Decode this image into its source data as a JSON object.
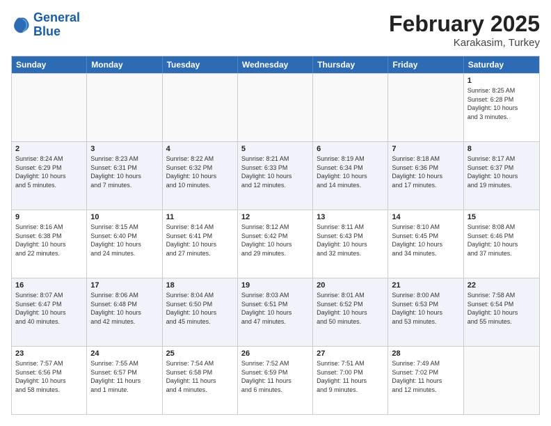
{
  "logo": {
    "line1": "General",
    "line2": "Blue"
  },
  "title": "February 2025",
  "subtitle": "Karakasim, Turkey",
  "days_of_week": [
    "Sunday",
    "Monday",
    "Tuesday",
    "Wednesday",
    "Thursday",
    "Friday",
    "Saturday"
  ],
  "weeks": [
    {
      "alt": false,
      "cells": [
        {
          "day": "",
          "info": ""
        },
        {
          "day": "",
          "info": ""
        },
        {
          "day": "",
          "info": ""
        },
        {
          "day": "",
          "info": ""
        },
        {
          "day": "",
          "info": ""
        },
        {
          "day": "",
          "info": ""
        },
        {
          "day": "1",
          "info": "Sunrise: 8:25 AM\nSunset: 6:28 PM\nDaylight: 10 hours\nand 3 minutes."
        }
      ]
    },
    {
      "alt": true,
      "cells": [
        {
          "day": "2",
          "info": "Sunrise: 8:24 AM\nSunset: 6:29 PM\nDaylight: 10 hours\nand 5 minutes."
        },
        {
          "day": "3",
          "info": "Sunrise: 8:23 AM\nSunset: 6:31 PM\nDaylight: 10 hours\nand 7 minutes."
        },
        {
          "day": "4",
          "info": "Sunrise: 8:22 AM\nSunset: 6:32 PM\nDaylight: 10 hours\nand 10 minutes."
        },
        {
          "day": "5",
          "info": "Sunrise: 8:21 AM\nSunset: 6:33 PM\nDaylight: 10 hours\nand 12 minutes."
        },
        {
          "day": "6",
          "info": "Sunrise: 8:19 AM\nSunset: 6:34 PM\nDaylight: 10 hours\nand 14 minutes."
        },
        {
          "day": "7",
          "info": "Sunrise: 8:18 AM\nSunset: 6:36 PM\nDaylight: 10 hours\nand 17 minutes."
        },
        {
          "day": "8",
          "info": "Sunrise: 8:17 AM\nSunset: 6:37 PM\nDaylight: 10 hours\nand 19 minutes."
        }
      ]
    },
    {
      "alt": false,
      "cells": [
        {
          "day": "9",
          "info": "Sunrise: 8:16 AM\nSunset: 6:38 PM\nDaylight: 10 hours\nand 22 minutes."
        },
        {
          "day": "10",
          "info": "Sunrise: 8:15 AM\nSunset: 6:40 PM\nDaylight: 10 hours\nand 24 minutes."
        },
        {
          "day": "11",
          "info": "Sunrise: 8:14 AM\nSunset: 6:41 PM\nDaylight: 10 hours\nand 27 minutes."
        },
        {
          "day": "12",
          "info": "Sunrise: 8:12 AM\nSunset: 6:42 PM\nDaylight: 10 hours\nand 29 minutes."
        },
        {
          "day": "13",
          "info": "Sunrise: 8:11 AM\nSunset: 6:43 PM\nDaylight: 10 hours\nand 32 minutes."
        },
        {
          "day": "14",
          "info": "Sunrise: 8:10 AM\nSunset: 6:45 PM\nDaylight: 10 hours\nand 34 minutes."
        },
        {
          "day": "15",
          "info": "Sunrise: 8:08 AM\nSunset: 6:46 PM\nDaylight: 10 hours\nand 37 minutes."
        }
      ]
    },
    {
      "alt": true,
      "cells": [
        {
          "day": "16",
          "info": "Sunrise: 8:07 AM\nSunset: 6:47 PM\nDaylight: 10 hours\nand 40 minutes."
        },
        {
          "day": "17",
          "info": "Sunrise: 8:06 AM\nSunset: 6:48 PM\nDaylight: 10 hours\nand 42 minutes."
        },
        {
          "day": "18",
          "info": "Sunrise: 8:04 AM\nSunset: 6:50 PM\nDaylight: 10 hours\nand 45 minutes."
        },
        {
          "day": "19",
          "info": "Sunrise: 8:03 AM\nSunset: 6:51 PM\nDaylight: 10 hours\nand 47 minutes."
        },
        {
          "day": "20",
          "info": "Sunrise: 8:01 AM\nSunset: 6:52 PM\nDaylight: 10 hours\nand 50 minutes."
        },
        {
          "day": "21",
          "info": "Sunrise: 8:00 AM\nSunset: 6:53 PM\nDaylight: 10 hours\nand 53 minutes."
        },
        {
          "day": "22",
          "info": "Sunrise: 7:58 AM\nSunset: 6:54 PM\nDaylight: 10 hours\nand 55 minutes."
        }
      ]
    },
    {
      "alt": false,
      "cells": [
        {
          "day": "23",
          "info": "Sunrise: 7:57 AM\nSunset: 6:56 PM\nDaylight: 10 hours\nand 58 minutes."
        },
        {
          "day": "24",
          "info": "Sunrise: 7:55 AM\nSunset: 6:57 PM\nDaylight: 11 hours\nand 1 minute."
        },
        {
          "day": "25",
          "info": "Sunrise: 7:54 AM\nSunset: 6:58 PM\nDaylight: 11 hours\nand 4 minutes."
        },
        {
          "day": "26",
          "info": "Sunrise: 7:52 AM\nSunset: 6:59 PM\nDaylight: 11 hours\nand 6 minutes."
        },
        {
          "day": "27",
          "info": "Sunrise: 7:51 AM\nSunset: 7:00 PM\nDaylight: 11 hours\nand 9 minutes."
        },
        {
          "day": "28",
          "info": "Sunrise: 7:49 AM\nSunset: 7:02 PM\nDaylight: 11 hours\nand 12 minutes."
        },
        {
          "day": "",
          "info": ""
        }
      ]
    }
  ]
}
